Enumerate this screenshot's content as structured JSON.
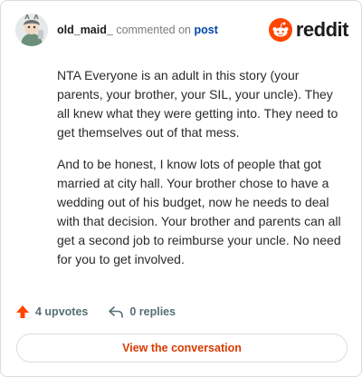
{
  "comment": {
    "username": "old_maid_",
    "verb": "commented on",
    "post_link": "post",
    "paragraphs": [
      "NTA Everyone is an adult in this story (your parents, your brother, your SIL, your uncle). They all knew what they were getting into. They need to get themselves out of that mess.",
      "And to be honest, I know lots of people that got married at city hall. Your brother chose to have a wedding out of his budget, now he needs to deal with that decision. Your brother and parents can all get a second job to reimburse your uncle. No need for you to get involved."
    ]
  },
  "brand": {
    "wordmark": "reddit",
    "color": "#ff4500"
  },
  "actions": {
    "upvotes": "4 upvotes",
    "replies": "0 replies"
  },
  "cta": {
    "label": "View the conversation"
  },
  "icons": [
    "avatar",
    "reddit-logo-icon",
    "upvote-arrow-icon",
    "reply-arrow-icon"
  ],
  "colors": {
    "accent": "#ff4500",
    "link": "#0045ac",
    "cta_text": "#d93a00",
    "muted": "#576f76"
  }
}
